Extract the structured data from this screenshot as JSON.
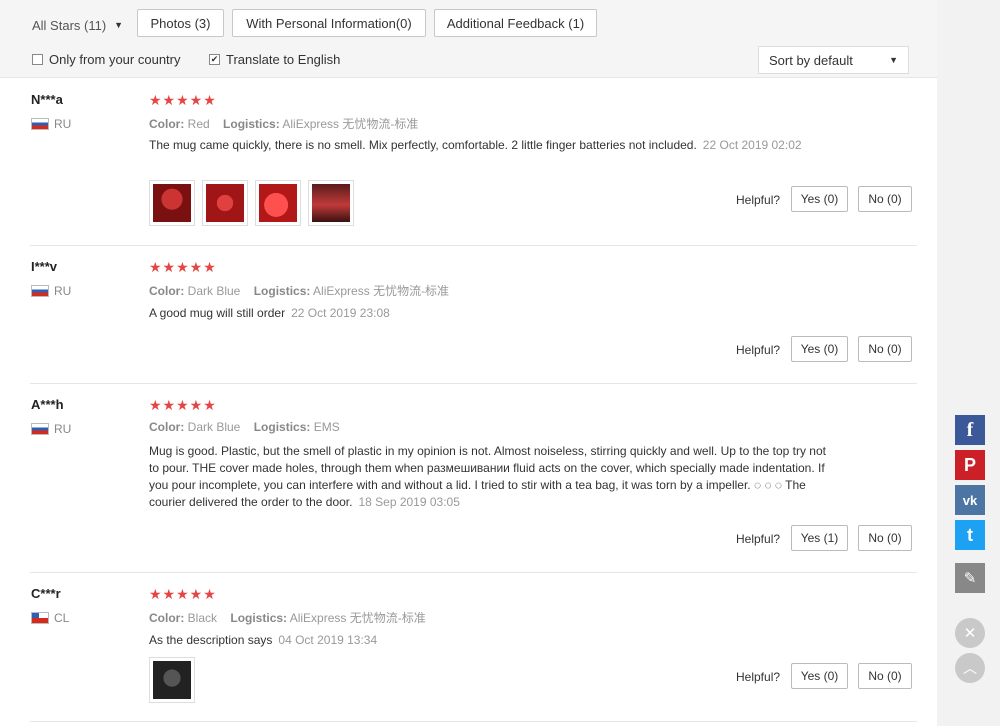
{
  "filters": {
    "stars_label": "All Stars (11)",
    "photos": "Photos (3)",
    "personal_info": "With Personal Information(0)",
    "additional_feedback": "Additional Feedback (1)",
    "only_country": "Only from your country",
    "translate": "Translate to English",
    "sort": "Sort by default"
  },
  "helpful_label": "Helpful?",
  "reviews": [
    {
      "user": "N***a",
      "country": "RU",
      "stars": "★★★★★",
      "color_label": "Color:",
      "color": "Red",
      "logistics_label": "Logistics:",
      "logistics": "AliExpress 无忧物流-标准",
      "text": "The mug came quickly, there is no smell. Mix perfectly, comfortable. 2 little finger batteries not included.",
      "date": "22 Oct 2019 02:02",
      "yes": "Yes (0)",
      "no": "No (0)"
    },
    {
      "user": "I***v",
      "country": "RU",
      "stars": "★★★★★",
      "color_label": "Color:",
      "color": "Dark Blue",
      "logistics_label": "Logistics:",
      "logistics": "AliExpress 无忧物流-标准",
      "text": "A good mug will still order",
      "date": "22 Oct 2019 23:08",
      "yes": "Yes (0)",
      "no": "No (0)"
    },
    {
      "user": "A***h",
      "country": "RU",
      "stars": "★★★★★",
      "color_label": "Color:",
      "color": "Dark Blue",
      "logistics_label": "Logistics:",
      "logistics": "EMS",
      "text": "Mug is good. Plastic, but the smell of plastic in my opinion is not. Almost noiseless, stirring quickly and well. Up to the top try not to pour. THE cover made holes, through them when размешивании fluid acts on the cover, which specially made indentation. If you pour incomplete, you can interfere with and without a lid. I tried to stir with a tea bag, it was torn by a impeller. ◌ ◌ ◌ The courier delivered the order to the door.",
      "date": "18 Sep 2019 03:05",
      "yes": "Yes (1)",
      "no": "No (0)"
    },
    {
      "user": "C***r",
      "country": "CL",
      "stars": "★★★★★",
      "color_label": "Color:",
      "color": "Black",
      "logistics_label": "Logistics:",
      "logistics": "AliExpress 无忧物流-标准",
      "text": "As the description says",
      "date": "04 Oct 2019 13:34",
      "yes": "Yes (0)",
      "no": "No (0)"
    }
  ],
  "share": {
    "facebook": "f",
    "pinterest": "P",
    "vk": "vk",
    "twitter": "t",
    "edit": "✎",
    "close": "✕",
    "up": "︿"
  },
  "colors": {
    "star": "#e64545",
    "facebook": "#3b5998",
    "pinterest": "#cb2027",
    "vk": "#4c75a3",
    "twitter": "#1da1f2",
    "edit": "#888888"
  }
}
